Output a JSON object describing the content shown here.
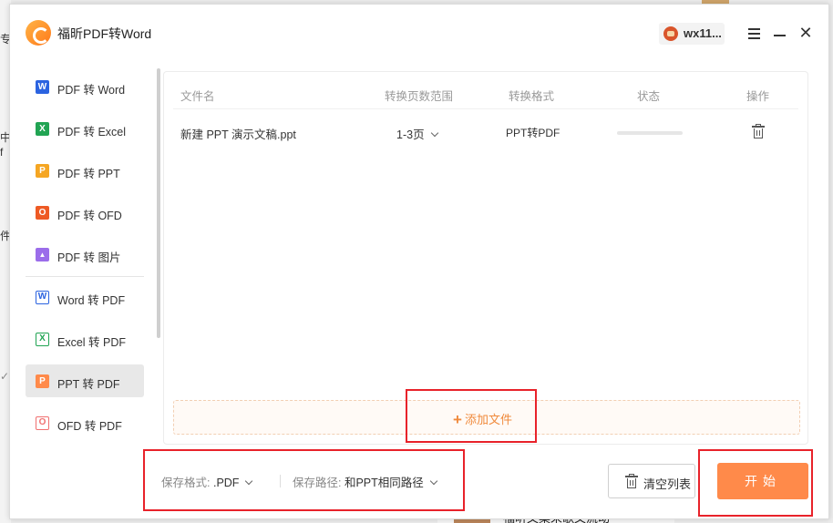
{
  "background": {
    "left_fragments": [
      "专",
      "中",
      "f",
      "件",
      "✓"
    ],
    "bottom_text": "福昕文案采歌文流动"
  },
  "app": {
    "title": "福昕PDF转Word",
    "user_name": "wx11...",
    "accent_color": "#ff8a4a"
  },
  "sidebar": {
    "items": [
      {
        "label": "PDF 转 Word",
        "icon": "W",
        "icon_color": "#2b63e0"
      },
      {
        "label": "PDF 转 Excel",
        "icon": "X",
        "icon_color": "#21a453"
      },
      {
        "label": "PDF 转 PPT",
        "icon": "P",
        "icon_color": "#f5a623"
      },
      {
        "label": "PDF 转 OFD",
        "icon": "O",
        "icon_color": "#ee5a24"
      },
      {
        "label": "PDF 转 图片",
        "icon": "▲",
        "icon_color": "#9b6dea"
      },
      {
        "label": "Word 转 PDF",
        "icon": "W",
        "icon_color": "#2b63e0"
      },
      {
        "label": "Excel 转 PDF",
        "icon": "X",
        "icon_color": "#21a453"
      },
      {
        "label": "PPT 转 PDF",
        "icon": "P",
        "icon_color": "#ff8a4a"
      },
      {
        "label": "OFD 转 PDF",
        "icon": "O",
        "icon_color": "#f07070"
      }
    ],
    "active": "PPT 转 PDF"
  },
  "table": {
    "headers": {
      "filename": "文件名",
      "page_range": "转换页数范围",
      "format": "转换格式",
      "status": "状态",
      "action": "操作"
    },
    "rows": [
      {
        "filename": "新建 PPT 演示文稿.ppt",
        "page_range": "1-3页",
        "format": "PPT转PDF",
        "progress": 0
      }
    ]
  },
  "add_file_label": "添加文件",
  "bottom": {
    "save_format_label": "保存格式:",
    "save_format_value": ".PDF",
    "save_path_label": "保存路径:",
    "save_path_value": "和PPT相同路径",
    "clear_label": "清空列表",
    "start_label": "开始"
  }
}
